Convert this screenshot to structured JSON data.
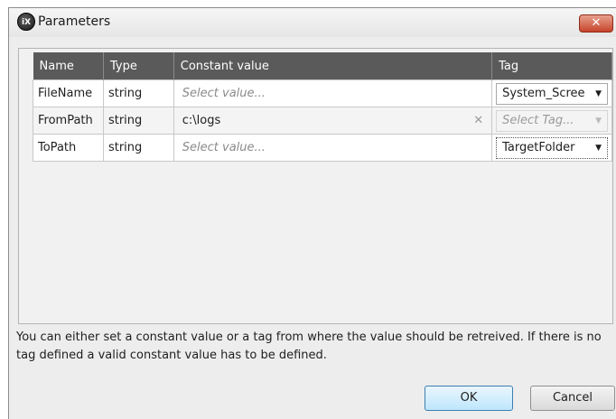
{
  "dialog": {
    "title": "Parameters",
    "app_icon": "iX"
  },
  "table": {
    "headers": {
      "name": "Name",
      "type": "Type",
      "constant_value": "Constant value",
      "tag": "Tag"
    },
    "rows": [
      {
        "name": "FileName",
        "type": "string",
        "constant_value": "",
        "constant_placeholder": "Select value...",
        "tag": "System_Scree"
      },
      {
        "name": "FromPath",
        "type": "string",
        "constant_value": "c:\\logs",
        "constant_placeholder": "",
        "tag": "Select Tag..."
      },
      {
        "name": "ToPath",
        "type": "string",
        "constant_value": "",
        "constant_placeholder": "Select value...",
        "tag": "TargetFolder"
      }
    ]
  },
  "hint_text": "You can either set a constant value or a tag from where the value should be retreived. If there is no tag defined a valid constant value has to be defined.",
  "buttons": {
    "ok": "OK",
    "cancel": "Cancel"
  },
  "icons": {
    "close": "close-icon",
    "dropdown": "dropdown-arrow-icon",
    "clear": "clear-icon"
  }
}
